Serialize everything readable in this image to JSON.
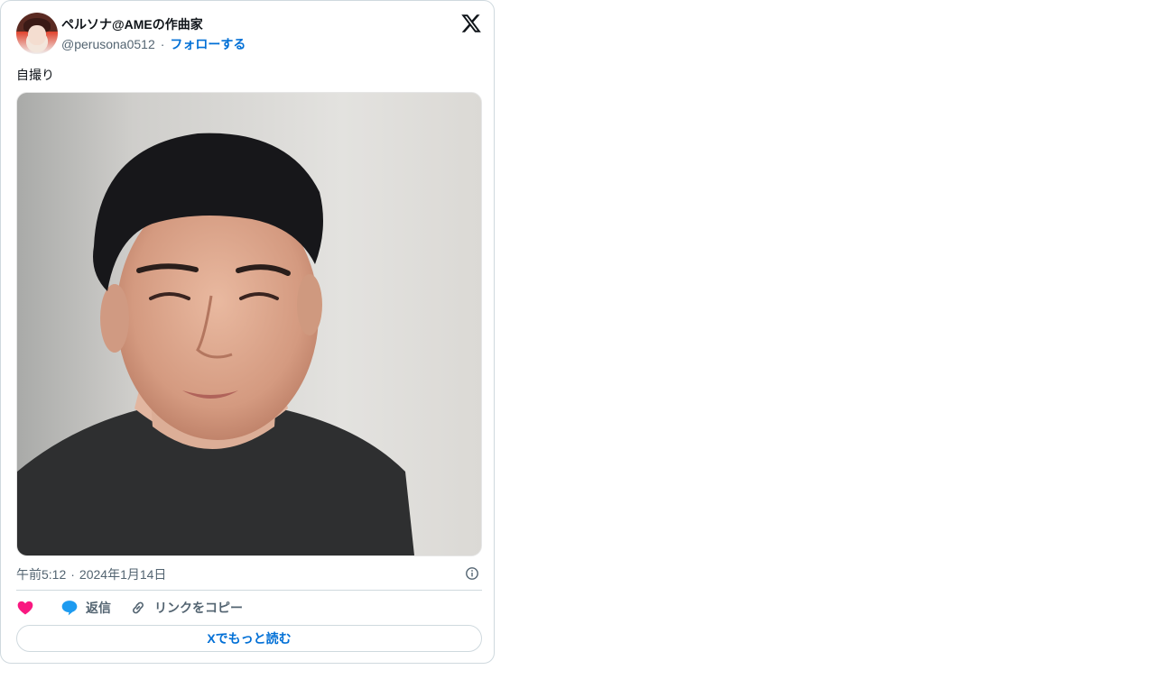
{
  "author": {
    "display_name": "ペルソナ@AMEの作曲家",
    "handle": "@perusona0512",
    "separator": "·",
    "follow_label": "フォローする"
  },
  "post": {
    "text": "自撮り",
    "image_alt": "selfie photo",
    "time": "午前5:12",
    "separator": "·",
    "date": "2024年1月14日"
  },
  "actions": {
    "like_icon": "heart-icon",
    "reply_icon": "speech-bubble-icon",
    "reply_label": "返信",
    "copy_icon": "link-icon",
    "copy_label": "リンクをコピー"
  },
  "footer": {
    "read_more_label": "Xでもっと読む"
  },
  "colors": {
    "link": "#006fd6",
    "like": "#f91880",
    "reply": "#1d9bf0",
    "muted": "#536471",
    "border": "#cfd9de"
  }
}
